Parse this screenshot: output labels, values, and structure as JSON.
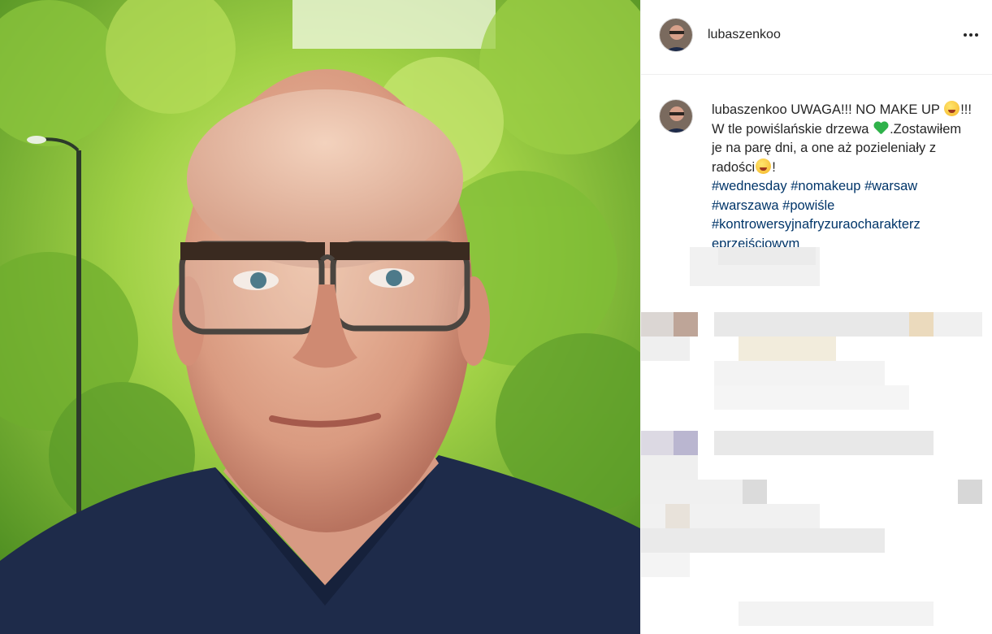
{
  "post": {
    "username": "lubaszenkoo",
    "more_icon": "ellipsis-icon",
    "caption": {
      "username": "lubaszenkoo",
      "text_1": "UWAGA!!! NO MAKE UP",
      "emoji_1": "face-tongue-icon",
      "text_2": "!!! W tle powiślańskie drzewa",
      "emoji_2": "green-heart-icon",
      "text_3": ".Zostawiłem je na parę dni, a one aż pozieleniały z radości",
      "emoji_3": "face-tears-of-joy-icon",
      "text_4": "!",
      "hashtags": [
        "#wednesday",
        "#nomakeup",
        "#warsaw",
        "#warszawa",
        "#powiśle",
        "#kontrowersyjnafryzuraocharakterz",
        "eprzejściowym"
      ]
    },
    "comments_section": "blurred-comments"
  },
  "colors": {
    "hashtag": "#003569",
    "text": "#262626",
    "border": "#efefef"
  }
}
